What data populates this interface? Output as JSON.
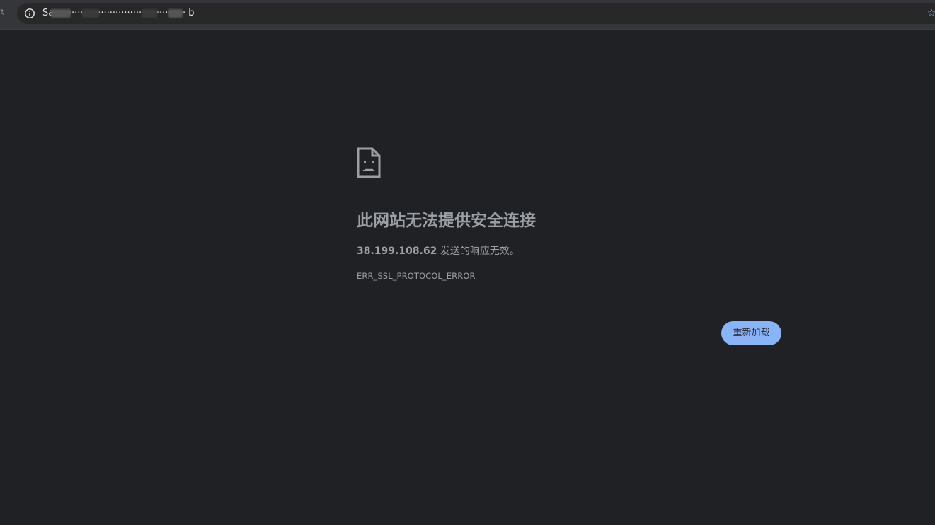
{
  "toolbar": {
    "url_text": "Sa············································· b",
    "info_icon": "info-icon",
    "star_icon": "star-icon"
  },
  "error_page": {
    "icon": "sad-page-icon",
    "heading": "此网站无法提供安全连接",
    "host": "38.199.108.62",
    "message_suffix": " 发送的响应无效。",
    "error_code": "ERR_SSL_PROTOCOL_ERROR",
    "reload_label": "重新加载"
  },
  "colors": {
    "background": "#202124",
    "text": "#9aa0a6",
    "accent": "#8ab4f8"
  }
}
